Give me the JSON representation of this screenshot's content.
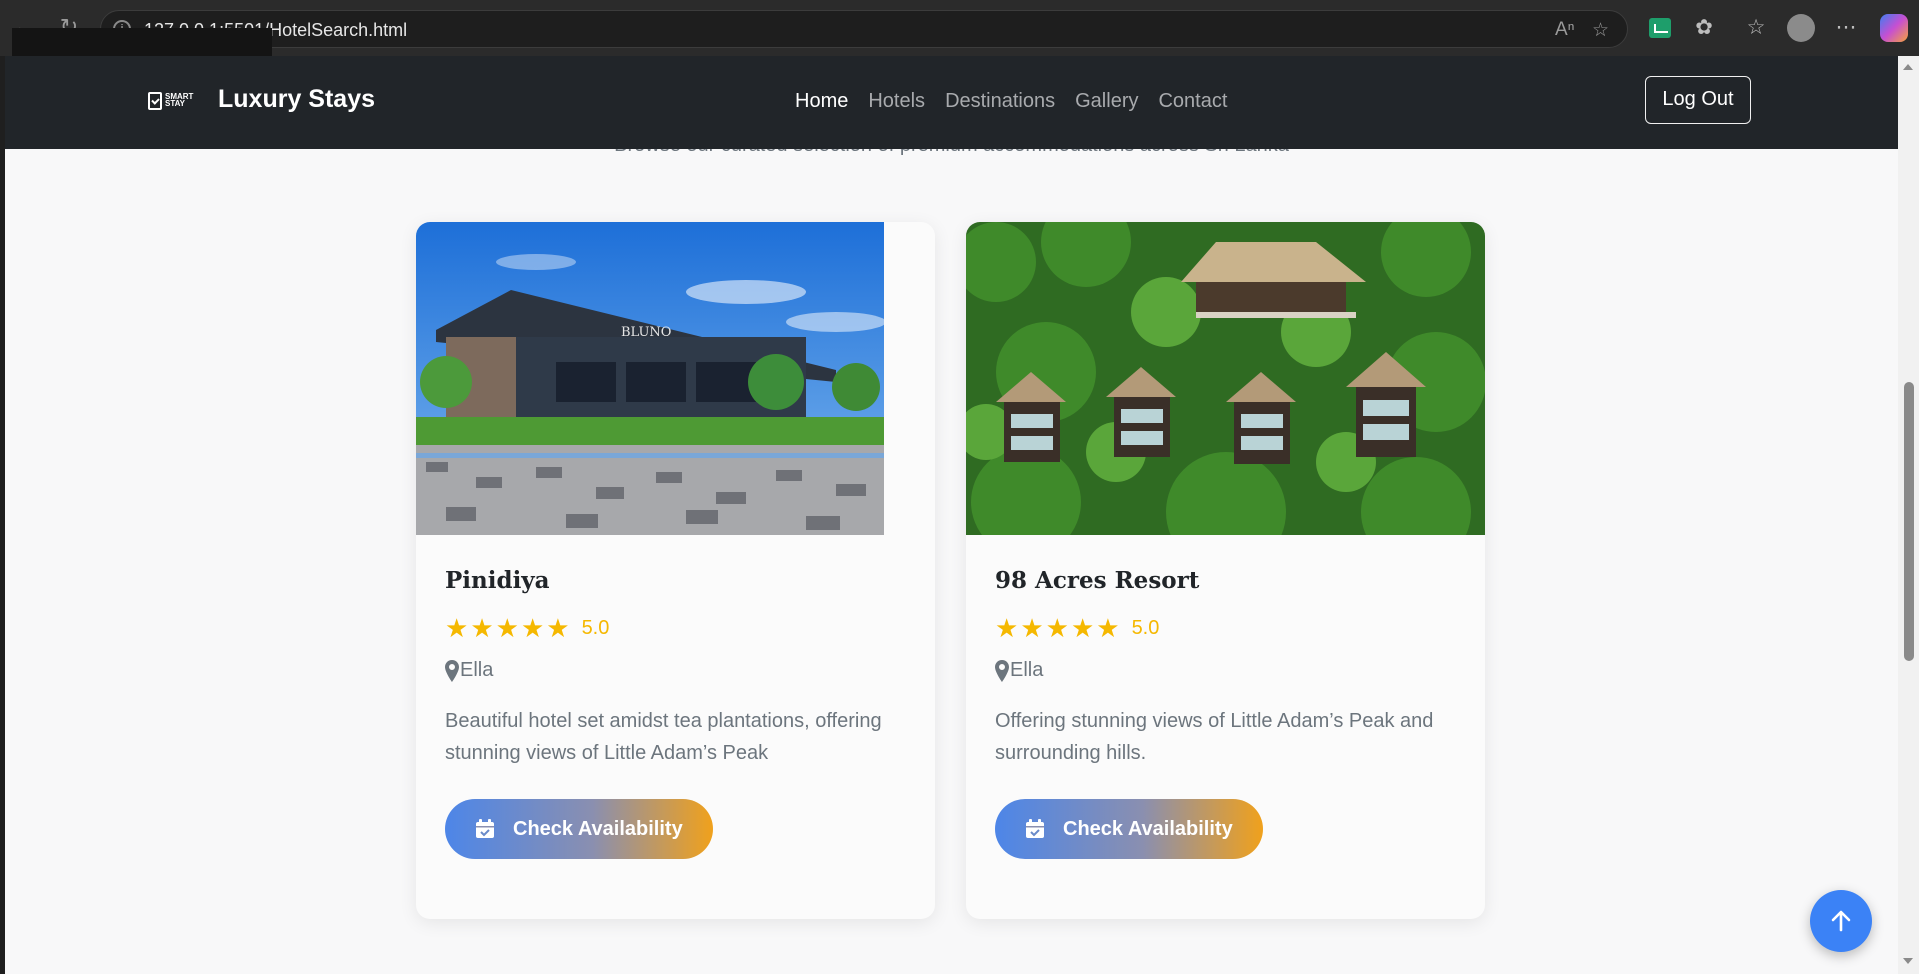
{
  "browser": {
    "url": "127.0.0.1:5501/HotelSearch.html"
  },
  "navbar": {
    "brand_logo_line1": "SMART",
    "brand_logo_line2": "STAY",
    "brand_name": "Luxury Stays",
    "links": [
      {
        "label": "Home",
        "active": true
      },
      {
        "label": "Hotels",
        "active": false
      },
      {
        "label": "Destinations",
        "active": false
      },
      {
        "label": "Gallery",
        "active": false
      },
      {
        "label": "Contact",
        "active": false
      }
    ],
    "logout_label": "Log Out"
  },
  "subtitle": "Browse our curated selection of premium accommodations across Sri Lanka",
  "hotels": [
    {
      "name": "Pinidiya",
      "rating_stars": 5,
      "rating": "5.0",
      "location": "Ella",
      "description": "Beautiful hotel set amidst tea plantations, offering stunning views of Little Adam’s Peak",
      "button_label": "Check Availability",
      "image_sign": "BLUNO"
    },
    {
      "name": "98 Acres Resort",
      "rating_stars": 5,
      "rating": "5.0",
      "location": "Ella",
      "description": "Offering stunning views of Little Adam’s Peak and surrounding hills.",
      "button_label": "Check Availability"
    }
  ],
  "colors": {
    "navbar_bg": "#212529",
    "star": "#f5b800",
    "button_gradient_start": "#4d86e8",
    "button_gradient_end": "#f0a11c",
    "back_to_top": "#3b82f6"
  }
}
